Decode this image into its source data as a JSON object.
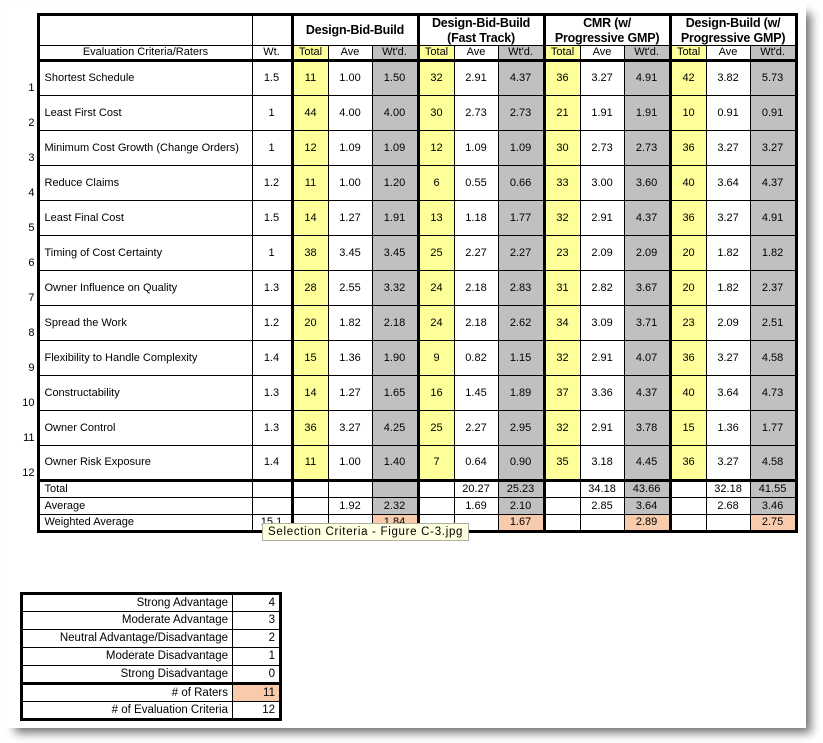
{
  "table": {
    "corner_header": "",
    "criteria_header": "Evaluation Criteria/Raters",
    "weight_header": "Wt.",
    "groups": [
      {
        "name": "Design-Bid-Build"
      },
      {
        "name": "Design-Bid-Build (Fast Track)"
      },
      {
        "name": "CMR (w/ Progressive GMP)"
      },
      {
        "name": "Design-Build (w/ Progressive GMP)"
      }
    ],
    "sub_headers": [
      "Total",
      "Ave",
      "Wt'd."
    ],
    "rows": [
      {
        "num": "1",
        "criteria": "Shortest Schedule",
        "wt": "1.5",
        "g": [
          [
            "11",
            "1.00",
            "1.50"
          ],
          [
            "32",
            "2.91",
            "4.37"
          ],
          [
            "36",
            "3.27",
            "4.91"
          ],
          [
            "42",
            "3.82",
            "5.73"
          ]
        ]
      },
      {
        "num": "2",
        "criteria": "Least First Cost",
        "wt": "1",
        "g": [
          [
            "44",
            "4.00",
            "4.00"
          ],
          [
            "30",
            "2.73",
            "2.73"
          ],
          [
            "21",
            "1.91",
            "1.91"
          ],
          [
            "10",
            "0.91",
            "0.91"
          ]
        ]
      },
      {
        "num": "3",
        "criteria": "Minimum Cost Growth (Change Orders)",
        "wt": "1",
        "g": [
          [
            "12",
            "1.09",
            "1.09"
          ],
          [
            "12",
            "1.09",
            "1.09"
          ],
          [
            "30",
            "2.73",
            "2.73"
          ],
          [
            "36",
            "3.27",
            "3.27"
          ]
        ]
      },
      {
        "num": "4",
        "criteria": "Reduce Claims",
        "wt": "1.2",
        "g": [
          [
            "11",
            "1.00",
            "1.20"
          ],
          [
            "6",
            "0.55",
            "0.66"
          ],
          [
            "33",
            "3.00",
            "3.60"
          ],
          [
            "40",
            "3.64",
            "4.37"
          ]
        ]
      },
      {
        "num": "5",
        "criteria": "Least Final Cost",
        "wt": "1.5",
        "g": [
          [
            "14",
            "1.27",
            "1.91"
          ],
          [
            "13",
            "1.18",
            "1.77"
          ],
          [
            "32",
            "2.91",
            "4.37"
          ],
          [
            "36",
            "3.27",
            "4.91"
          ]
        ]
      },
      {
        "num": "6",
        "criteria": "Timing of Cost Certainty",
        "wt": "1",
        "g": [
          [
            "38",
            "3.45",
            "3.45"
          ],
          [
            "25",
            "2.27",
            "2.27"
          ],
          [
            "23",
            "2.09",
            "2.09"
          ],
          [
            "20",
            "1.82",
            "1.82"
          ]
        ]
      },
      {
        "num": "7",
        "criteria": "Owner Influence on Quality",
        "wt": "1.3",
        "g": [
          [
            "28",
            "2.55",
            "3.32"
          ],
          [
            "24",
            "2.18",
            "2.83"
          ],
          [
            "31",
            "2.82",
            "3.67"
          ],
          [
            "20",
            "1.82",
            "2.37"
          ]
        ]
      },
      {
        "num": "8",
        "criteria": "Spread the Work",
        "wt": "1.2",
        "g": [
          [
            "20",
            "1.82",
            "2.18"
          ],
          [
            "24",
            "2.18",
            "2.62"
          ],
          [
            "34",
            "3.09",
            "3.71"
          ],
          [
            "23",
            "2.09",
            "2.51"
          ]
        ]
      },
      {
        "num": "9",
        "criteria": "Flexibility to Handle Complexity",
        "wt": "1.4",
        "g": [
          [
            "15",
            "1.36",
            "1.90"
          ],
          [
            "9",
            "0.82",
            "1.15"
          ],
          [
            "32",
            "2.91",
            "4.07"
          ],
          [
            "36",
            "3.27",
            "4.58"
          ]
        ]
      },
      {
        "num": "10",
        "criteria": "Constructability",
        "wt": "1.3",
        "g": [
          [
            "14",
            "1.27",
            "1.65"
          ],
          [
            "16",
            "1.45",
            "1.89"
          ],
          [
            "37",
            "3.36",
            "4.37"
          ],
          [
            "40",
            "3.64",
            "4.73"
          ]
        ]
      },
      {
        "num": "11",
        "criteria": "Owner Control",
        "wt": "1.3",
        "g": [
          [
            "36",
            "3.27",
            "4.25"
          ],
          [
            "25",
            "2.27",
            "2.95"
          ],
          [
            "32",
            "2.91",
            "3.78"
          ],
          [
            "15",
            "1.36",
            "1.77"
          ]
        ]
      },
      {
        "num": "12",
        "criteria": "Owner Risk Exposure",
        "wt": "1.4",
        "g": [
          [
            "11",
            "1.00",
            "1.40"
          ],
          [
            "7",
            "0.64",
            "0.90"
          ],
          [
            "35",
            "3.18",
            "4.45"
          ],
          [
            "36",
            "3.27",
            "4.58"
          ]
        ]
      }
    ],
    "summary": [
      {
        "label": "Total",
        "wt": "",
        "g": [
          [
            "",
            "",
            ""
          ],
          [
            "",
            "20.27",
            "25.23"
          ],
          [
            "",
            "34.18",
            "43.66"
          ],
          [
            "",
            "32.18",
            "41.55"
          ]
        ]
      },
      {
        "label": "Average",
        "wt": "",
        "g": [
          [
            "",
            "1.92",
            "2.32"
          ],
          [
            "",
            "1.69",
            "2.10"
          ],
          [
            "",
            "2.85",
            "3.64"
          ],
          [
            "",
            "2.68",
            "3.46"
          ]
        ]
      },
      {
        "label": "Weighted Average",
        "wt": "15.1",
        "g": [
          [
            "",
            "",
            "1.84"
          ],
          [
            "",
            "",
            "1.67"
          ],
          [
            "",
            "",
            "2.89"
          ],
          [
            "",
            "",
            "2.75"
          ]
        ]
      }
    ]
  },
  "legend": {
    "rows": [
      {
        "label": "Strong Advantage",
        "value": "4",
        "highlight": false
      },
      {
        "label": "Moderate Advantage",
        "value": "3",
        "highlight": false
      },
      {
        "label": "Neutral Advantage/Disadvantage",
        "value": "2",
        "highlight": false
      },
      {
        "label": "Moderate Disadvantage",
        "value": "1",
        "highlight": false
      },
      {
        "label": "Strong Disadvantage",
        "value": "0",
        "highlight": false
      },
      {
        "label": "# of Raters",
        "value": "11",
        "highlight": true
      },
      {
        "label": "# of Evaluation Criteria",
        "value": "12",
        "highlight": false
      }
    ]
  },
  "tooltip": {
    "text": "Selection Criteria - Figure C-3.jpg"
  },
  "colors": {
    "total_column": "#ffff99",
    "weighted_column": "#c0c0c0",
    "highlight": "#f8cbad",
    "tooltip_bg": "#ffffe1",
    "border": "#000000"
  }
}
